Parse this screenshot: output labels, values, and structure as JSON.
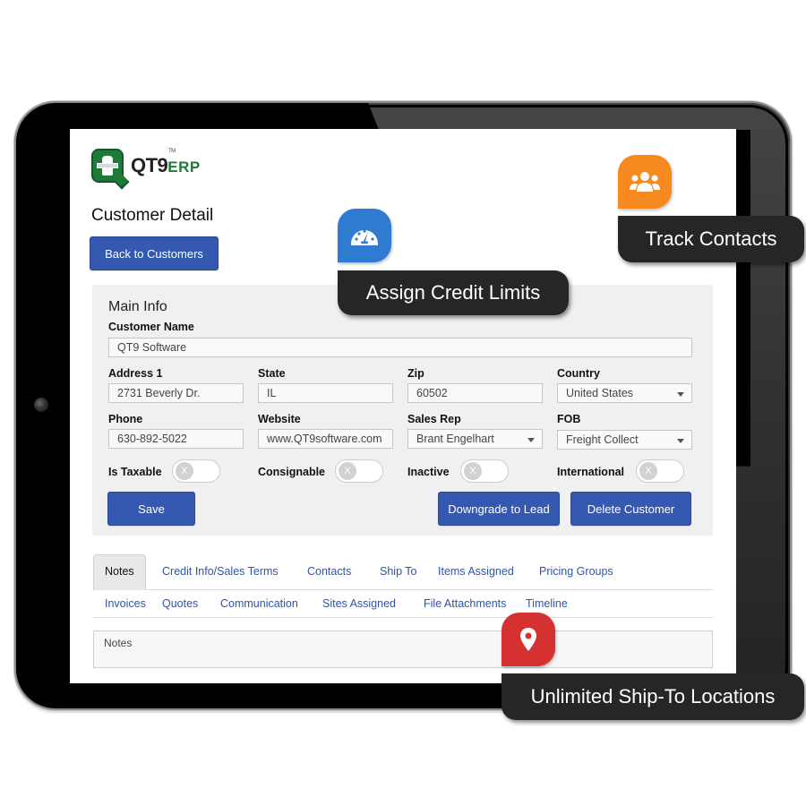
{
  "app": {
    "logo_text": "QT9",
    "logo_suffix": "ERP",
    "logo_tm": "TM"
  },
  "page": {
    "title": "Customer Detail",
    "back_button": "Back to Customers"
  },
  "main_info": {
    "title": "Main Info",
    "customer_name_label": "Customer Name",
    "customer_name_value": "QT9 Software",
    "address1_label": "Address 1",
    "address1_value": "2731 Beverly Dr.",
    "state_label": "State",
    "state_value": "IL",
    "zip_label": "Zip",
    "zip_value": "60502",
    "country_label": "Country",
    "country_value": "United States",
    "phone_label": "Phone",
    "phone_value": "630-892-5022",
    "website_label": "Website",
    "website_value": "www.QT9software.com",
    "sales_rep_label": "Sales Rep",
    "sales_rep_value": "Brant Engelhart",
    "fob_label": "FOB",
    "fob_value": "Freight Collect",
    "toggles": [
      {
        "label": "Is Taxable",
        "state": "off",
        "glyph": "X"
      },
      {
        "label": "Consignable",
        "state": "off",
        "glyph": "X"
      },
      {
        "label": "Inactive",
        "state": "off",
        "glyph": "X"
      },
      {
        "label": "International",
        "state": "off",
        "glyph": "X"
      }
    ],
    "save_button": "Save",
    "downgrade_button": "Downgrade to Lead",
    "delete_button": "Delete Customer"
  },
  "tabs": {
    "row1": [
      "Notes",
      "Credit Info/Sales Terms",
      "Contacts",
      "Ship To",
      "Items Assigned",
      "Pricing Groups"
    ],
    "row2": [
      "Invoices",
      "Quotes",
      "Communication",
      "Sites Assigned",
      "File Attachments",
      "Timeline"
    ],
    "active": "Notes"
  },
  "notes": {
    "label": "Notes"
  },
  "callouts": {
    "credit": {
      "label": "Assign Credit Limits",
      "icon": "gauge-icon",
      "color": "#2f7bd1"
    },
    "contacts": {
      "label": "Track Contacts",
      "icon": "users-icon",
      "color": "#f68a21"
    },
    "shipto": {
      "label": "Unlimited Ship-To Locations",
      "icon": "map-pin-icon",
      "color": "#d63131"
    }
  },
  "colors": {
    "primary_button": "#3558b0",
    "tab_link": "#2a55b0",
    "panel_bg": "#f0f0f2",
    "callout_bg": "#262626"
  }
}
